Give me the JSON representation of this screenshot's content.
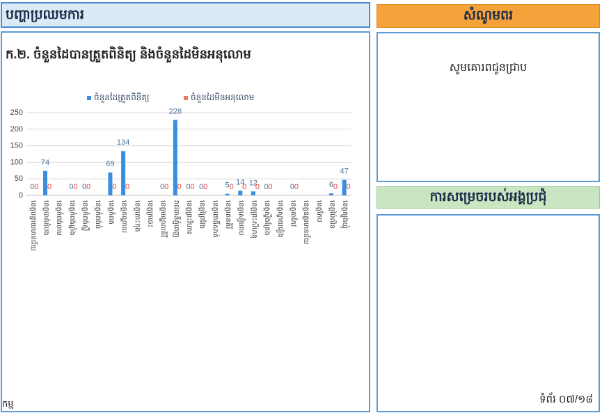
{
  "colors": {
    "panel_border": "#5b9bd5",
    "left_header_bg": "#dce9f6",
    "left_header_border": "#4a8ad4",
    "orange_header_bg": "#f4a23a",
    "green_header_bg": "#c7e6c1",
    "header_text": "#1f2b4a"
  },
  "left_header": {
    "title": "បញ្ហាប្រឈមការ"
  },
  "left_panel": {
    "footer_text": "កម្ម"
  },
  "right_top_header": {
    "title": "សំណូមពរ"
  },
  "right_top_panel": {
    "text": "សូមគោរពជូនជ្រាប"
  },
  "right_bottom_header": {
    "title": "ការសម្រេចរបស់អង្គប្រជុំ"
  },
  "right_bottom_panel": {
    "page_label": "ទំព័រ ០៧/១៨"
  },
  "chart_data": {
    "type": "bar",
    "title": "ក.២. ចំនួនដៃបានត្រួតពិនិត្យ និងចំនួនដៃមិនអនុលោម",
    "categories": [
      "ខេត្តបន្ទាយមានជ័យ",
      "ខេត្តបាត់ដំបង",
      "ខេត្តកំពង់ចាម",
      "ខេត្តកំពង់ឆ្នាំង",
      "ខេត្តកំពង់ស្ពឺ",
      "ខេត្តកំពង់ធំ",
      "ខេត្តកំពត",
      "ខេត្តកណ្ដាល",
      "ខេត្តកោះកុង",
      "ខេត្តក្រចេះ",
      "ខេត្តមណ្ឌលគិរី",
      "រាជធានីភ្នំពេញ",
      "ខេត្តព្រះវិហារ",
      "ខេត្តព្រៃវែង",
      "ខេត្តពោធិ៍សាត់",
      "ខេត្តរតនគិរី",
      "ខេត្តសៀមរាប",
      "ខេត្តព្រះសីហនុ",
      "ខេត្តស្ទឹងត្រែង",
      "ខេត្តស្វាយរៀង",
      "ខេត្តតាកែវ",
      "ខេត្តឧត្ដរមានជ័យ",
      "ខេត្តកែប",
      "ខេត្តប៉ៃលិន",
      "ខេត្តត្បូងឃ្មុំ"
    ],
    "series": [
      {
        "name": "ចំនួនដៃត្រួតពិនិត្យ",
        "color": "#3a8ee0",
        "label_color": "#4a6f98",
        "values": [
          0,
          74,
          null,
          0,
          0,
          null,
          69,
          134,
          null,
          null,
          0,
          228,
          0,
          0,
          null,
          5,
          14,
          12,
          0,
          null,
          0,
          null,
          null,
          6,
          47
        ]
      },
      {
        "name": "ចំនួនដៃមិនអនុលោម",
        "color": "#f0796b",
        "label_color": "#e0443c",
        "values": [
          0,
          0,
          null,
          0,
          0,
          null,
          0,
          0,
          null,
          null,
          0,
          0,
          0,
          0,
          null,
          0,
          0,
          0,
          0,
          null,
          0,
          null,
          null,
          0,
          0
        ]
      }
    ],
    "ylim": [
      0,
      250
    ],
    "yticks": [
      0,
      50,
      100,
      150,
      200,
      250
    ],
    "grid": true,
    "legend_position": "top",
    "data_labels": true
  }
}
